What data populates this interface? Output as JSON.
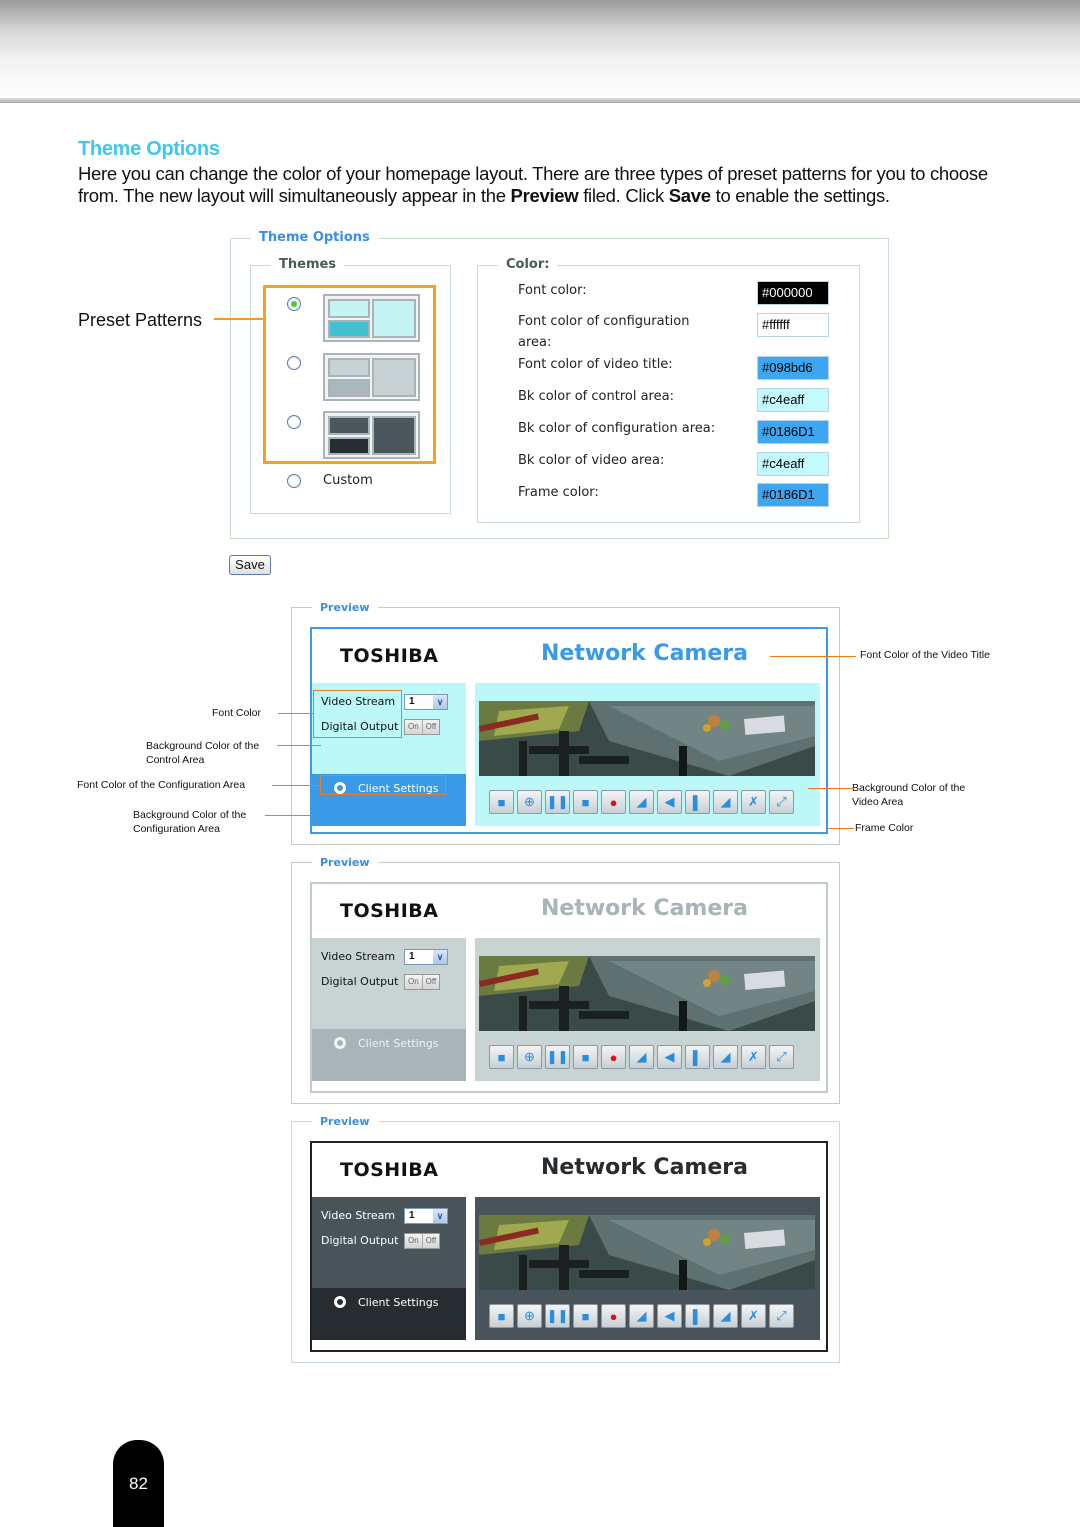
{
  "section_title": "Theme Options",
  "intro": {
    "part1": "Here you can change the color of your homepage layout. There are three types of preset patterns for you to choose from. The new layout will simultaneously appear in the ",
    "bold1": "Preview",
    "part2": " filed. Click ",
    "bold2": "Save",
    "part3": " to enable the settings."
  },
  "theme_options_panel": {
    "legend": "Theme Options",
    "themes": {
      "legend": "Themes",
      "preset_annotation": "Preset Patterns",
      "options": [
        {
          "name": "preset-1",
          "checked": true,
          "colors": {
            "ctrl": "#c4f4f4",
            "cfg": "#40c0d0",
            "video": "#c4f4f4"
          }
        },
        {
          "name": "preset-2",
          "checked": false,
          "colors": {
            "ctrl": "#c8d2d4",
            "cfg": "#aab8bc",
            "video": "#c8d2d4"
          }
        },
        {
          "name": "preset-3",
          "checked": false,
          "colors": {
            "ctrl": "#4a565c",
            "cfg": "#262c30",
            "video": "#4a565c"
          }
        },
        {
          "name": "custom",
          "checked": false,
          "label": "Custom"
        }
      ]
    },
    "color": {
      "legend": "Color:",
      "rows": [
        {
          "label": "Font color:",
          "value": "#000000",
          "bg": "#000000",
          "fg": "#ffffff"
        },
        {
          "label": "Font color of configuration area:",
          "value": "#ffffff",
          "bg": "#ffffff",
          "fg": "#000000"
        },
        {
          "label": "Font color of video title:",
          "value": "#098bd6",
          "bg": "#3ea6f0",
          "fg": "#000000"
        },
        {
          "label": "Bk color of control area:",
          "value": "#c4eaff",
          "bg": "#c4faff",
          "fg": "#000000"
        },
        {
          "label": "Bk color of configuration area:",
          "value": "#0186D1",
          "bg": "#3ea6f0",
          "fg": "#000000"
        },
        {
          "label": "Bk color of video area:",
          "value": "#c4eaff",
          "bg": "#c4faff",
          "fg": "#000000"
        },
        {
          "label": "Frame color:",
          "value": "#0186D1",
          "bg": "#3ea6f0",
          "fg": "#000000"
        }
      ]
    }
  },
  "save_label": "Save",
  "previews": [
    {
      "legend": "Preview",
      "brand": "TOSHIBA",
      "title": "Network Camera",
      "video_stream_label": "Video Stream",
      "video_stream_value": "1",
      "digital_output_label": "Digital Output",
      "on_label": "On",
      "off_label": "Off",
      "client_settings": "Client Settings",
      "colors": {
        "frame": "#3a9ae8",
        "title": "#3a9ae8",
        "ctrl_bg": "#bcf8f8",
        "ctrl_fg": "#111111",
        "cfg_bg": "#3a9ae8",
        "cfg_fg": "#ffffff",
        "video_bg": "#bcf8f8",
        "fs_border": "#c8c8c8"
      }
    },
    {
      "legend": "Preview",
      "brand": "TOSHIBA",
      "title": "Network Camera",
      "video_stream_label": "Video Stream",
      "video_stream_value": "1",
      "digital_output_label": "Digital Output",
      "on_label": "On",
      "off_label": "Off",
      "client_settings": "Client Settings",
      "colors": {
        "frame": "#c0cccc",
        "title": "#a8b4b8",
        "ctrl_bg": "#c8d4d4",
        "ctrl_fg": "#111111",
        "cfg_bg": "#a8b4b8",
        "cfg_fg": "#f0f4f4",
        "video_bg": "#c8d4d4",
        "fs_border": "#c8c8c8"
      }
    },
    {
      "legend": "Preview",
      "brand": "TOSHIBA",
      "title": "Network Camera",
      "video_stream_label": "Video Stream",
      "video_stream_value": "1",
      "digital_output_label": "Digital Output",
      "on_label": "On",
      "off_label": "Off",
      "client_settings": "Client Settings",
      "colors": {
        "frame": "#222222",
        "title": "#262c30",
        "ctrl_bg": "#48545a",
        "ctrl_fg": "#ffffff",
        "cfg_bg": "#262c30",
        "cfg_fg": "#ffffff",
        "video_bg": "#48545a",
        "fs_border": "#c8dcc8"
      }
    }
  ],
  "toolbar_icons": [
    "snapshot-icon",
    "zoom-icon",
    "pause-icon",
    "stop-icon",
    "record-icon",
    "volume-icon",
    "mute-icon",
    "talk-icon",
    "mic-volume-icon",
    "mic-mute-icon",
    "fullscreen-icon"
  ],
  "toolbar_glyphs": [
    "■",
    "⊕",
    "❚❚",
    "■",
    "●",
    "◢",
    "◀",
    "▌",
    "◢",
    "✗",
    "⤢"
  ],
  "annotations": {
    "font_color": "Font Color",
    "bg_control": "Background Color of the Control Area",
    "font_config": "Font Color of the Configuration Area",
    "bg_config": "Background Color of the Configuration Area",
    "video_title": "Font Color of the Video Title",
    "bg_video": "Background Color of the Video Area",
    "frame_color": "Frame Color"
  },
  "page_number": "82"
}
